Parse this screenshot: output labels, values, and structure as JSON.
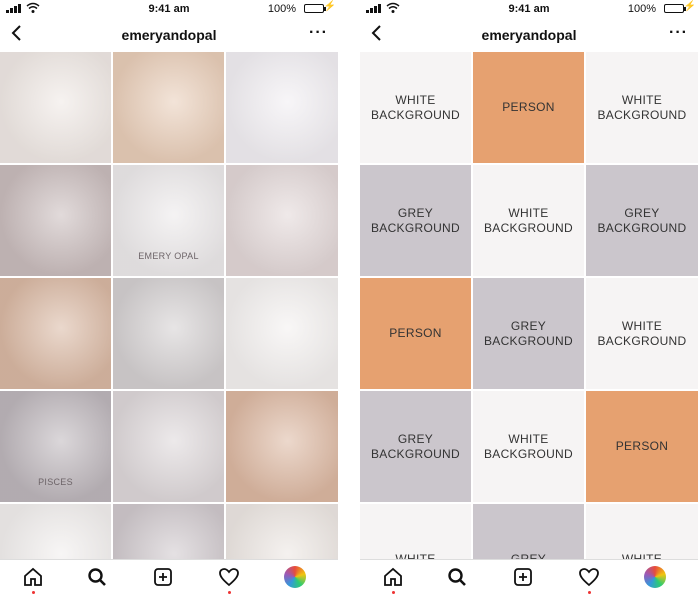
{
  "status_bar": {
    "time": "9:41 am",
    "battery": "100%",
    "battery_level": 1.0
  },
  "profile": {
    "username": "emeryandopal"
  },
  "header": {
    "back_icon": "chevron-left-icon",
    "more_icon": "more-icon",
    "more_glyph": "···"
  },
  "left_grid": {
    "cells": [
      {
        "name": "necklace-moon-star",
        "tone": "#efe8e4"
      },
      {
        "name": "necklace-pendant-person",
        "tone": "#e8cdb8"
      },
      {
        "name": "amethyst-crystals",
        "tone": "#f1eef2"
      },
      {
        "name": "rings-pearls",
        "tone": "#c9bcbc"
      },
      {
        "name": "emery-opal-cards",
        "tone": "#ece9ea",
        "text": "EMERY OPAL"
      },
      {
        "name": "bar-necklaces",
        "tone": "#e2d7d7"
      },
      {
        "name": "necklace-person-neck",
        "tone": "#d9b8a3"
      },
      {
        "name": "bar-pendant-marble",
        "tone": "#d3cfd0"
      },
      {
        "name": "chain-necklaces",
        "tone": "#f3f0ef"
      },
      {
        "name": "pisces-card",
        "tone": "#bdb6bb",
        "text": "PISCES"
      },
      {
        "name": "rings-marble",
        "tone": "#ddd7d9"
      },
      {
        "name": "star-necklace-person",
        "tone": "#dcb8a2"
      },
      {
        "name": "necklace-bottom-1",
        "tone": "#f1eeed"
      },
      {
        "name": "gift-box",
        "tone": "#cfc8cc"
      },
      {
        "name": "necklace-bottom-3",
        "tone": "#ece6e2"
      }
    ]
  },
  "right_grid": {
    "cells": [
      {
        "label": "WHITE\nBACKGROUND",
        "kind": "white"
      },
      {
        "label": "PERSON",
        "kind": "person"
      },
      {
        "label": "WHITE\nBACKGROUND",
        "kind": "white"
      },
      {
        "label": "GREY\nBACKGROUND",
        "kind": "grey"
      },
      {
        "label": "WHITE\nBACKGROUND",
        "kind": "white"
      },
      {
        "label": "GREY\nBACKGROUND",
        "kind": "grey"
      },
      {
        "label": "PERSON",
        "kind": "person"
      },
      {
        "label": "GREY\nBACKGROUND",
        "kind": "grey"
      },
      {
        "label": "WHITE\nBACKGROUND",
        "kind": "white"
      },
      {
        "label": "GREY\nBACKGROUND",
        "kind": "grey"
      },
      {
        "label": "WHITE\nBACKGROUND",
        "kind": "white"
      },
      {
        "label": "PERSON",
        "kind": "person"
      },
      {
        "label": "WHITE",
        "kind": "white"
      },
      {
        "label": "GREY",
        "kind": "grey"
      },
      {
        "label": "WHITE",
        "kind": "white"
      }
    ]
  },
  "bottom_nav": {
    "items": [
      {
        "name": "home-icon",
        "dot": true
      },
      {
        "name": "search-icon",
        "dot": false
      },
      {
        "name": "add-post-icon",
        "dot": false
      },
      {
        "name": "heart-icon",
        "dot": true
      },
      {
        "name": "profile-avatar-icon",
        "dot": false
      }
    ]
  },
  "colors": {
    "person": "#e6a170",
    "grey": "#cbc6cc",
    "white": "#f6f4f4",
    "accent": "#e33333"
  }
}
